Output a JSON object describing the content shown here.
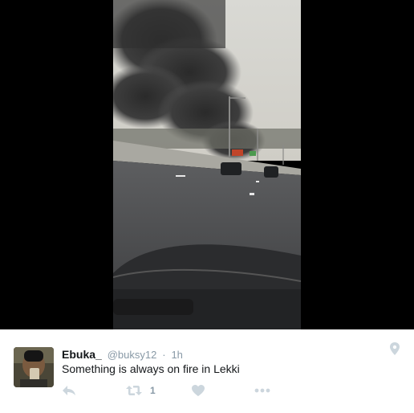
{
  "tweet": {
    "display_name": "Ebuka_",
    "handle": "@buksy12",
    "separator": "·",
    "time": "1h",
    "text": "Something is always on fire in Lekki",
    "retweet_count": "1"
  },
  "icons": {
    "location": "location-pin-icon",
    "reply": "reply-icon",
    "retweet": "retweet-icon",
    "like": "heart-icon",
    "more": "more-dots-icon"
  },
  "colors": {
    "icon_gray": "#ccd6dd",
    "meta_gray": "#8899a6",
    "text": "#14171a"
  }
}
